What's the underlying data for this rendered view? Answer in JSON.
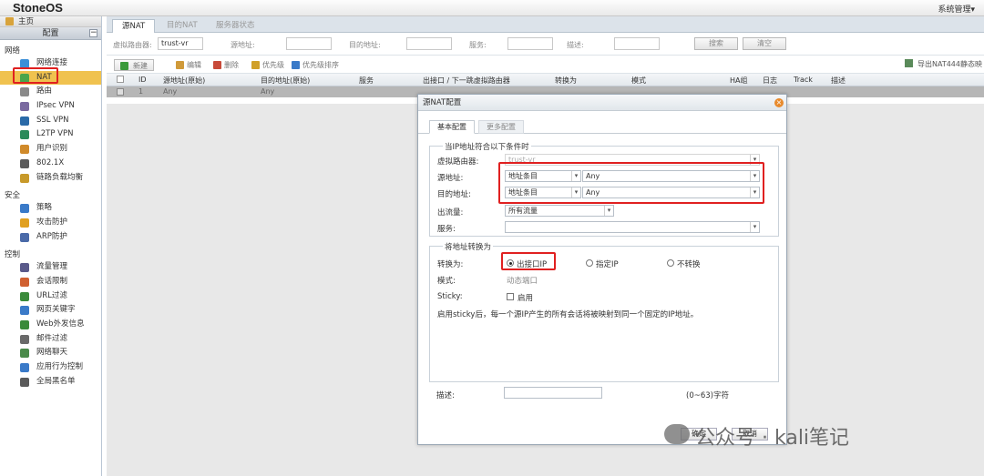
{
  "app": {
    "logo": "StoneOS",
    "system_menu": "系统管理▾"
  },
  "sidebar": {
    "home": "主页",
    "config": "配置",
    "collapse": "−",
    "sections": [
      {
        "title": "网络",
        "items": [
          {
            "label": "网络连接",
            "icon": "network-icon",
            "color": "#3a8fd8"
          },
          {
            "label": "NAT",
            "icon": "nat-icon",
            "color": "#4aa54a",
            "active": true
          },
          {
            "label": "路由",
            "icon": "route-icon",
            "color": "#8a8a8a"
          },
          {
            "label": "IPsec VPN",
            "icon": "vpn-icon",
            "color": "#7a6aa0"
          },
          {
            "label": "SSL VPN",
            "icon": "ssl-icon",
            "color": "#2a6aa8"
          },
          {
            "label": "L2TP VPN",
            "icon": "l2tp-icon",
            "color": "#2a8a5a"
          },
          {
            "label": "用户识别",
            "icon": "user-icon",
            "color": "#d08a2a"
          },
          {
            "label": "802.1X",
            "icon": "dot1x-icon",
            "color": "#5a5a5a"
          },
          {
            "label": "链路负载均衡",
            "icon": "balance-icon",
            "color": "#c89a2a"
          }
        ]
      },
      {
        "title": "安全",
        "items": [
          {
            "label": "策略",
            "icon": "policy-icon",
            "color": "#3a7ac8"
          },
          {
            "label": "攻击防护",
            "icon": "shield-icon",
            "color": "#e0a020"
          },
          {
            "label": "ARP防护",
            "icon": "arp-icon",
            "color": "#4a6aa8"
          }
        ]
      },
      {
        "title": "控制",
        "items": [
          {
            "label": "流量管理",
            "icon": "traffic-icon",
            "color": "#5a5a8a"
          },
          {
            "label": "会话限制",
            "icon": "session-icon",
            "color": "#d06030"
          },
          {
            "label": "URL过滤",
            "icon": "url-icon",
            "color": "#3a8a3a"
          },
          {
            "label": "网页关键字",
            "icon": "keyword-icon",
            "color": "#3a7ac8"
          },
          {
            "label": "Web外发信息",
            "icon": "web-icon",
            "color": "#3a8a3a"
          },
          {
            "label": "邮件过滤",
            "icon": "mail-icon",
            "color": "#6a6a6a"
          },
          {
            "label": "网络聊天",
            "icon": "chat-icon",
            "color": "#4a8a4a"
          },
          {
            "label": "应用行为控制",
            "icon": "app-icon",
            "color": "#3a7ac8"
          },
          {
            "label": "全局黑名单",
            "icon": "blacklist-icon",
            "color": "#5a5a5a"
          }
        ]
      }
    ]
  },
  "main": {
    "tabs": [
      "源NAT",
      "目的NAT",
      "服务器状态"
    ],
    "filter": {
      "vr_label": "虚拟路由器:",
      "vr_value": "trust-vr",
      "src_label": "源地址:",
      "dst_label": "目的地址:",
      "svc_label": "服务:",
      "desc_label": "描述:",
      "search": "搜索",
      "clear": "清空"
    },
    "toolbar": {
      "new": "新建",
      "edit": "编辑",
      "delete": "删除",
      "priority": "优先级",
      "priority_sort": "优先级排序",
      "export": "导出NAT444静态映"
    },
    "table": {
      "headers": [
        "ID",
        "源地址(原始)",
        "目的地址(原始)",
        "服务",
        "出接口 / 下一跳虚拟路由器",
        "转换为",
        "模式",
        "HA组",
        "日志",
        "Track",
        "描述"
      ],
      "rows": [
        {
          "id": "1",
          "src": "Any",
          "dst": "Any"
        }
      ]
    }
  },
  "dialog": {
    "title": "源NAT配置",
    "close": "×",
    "tabs": [
      "基本配置",
      "更多配置"
    ],
    "cond_legend": "当IP地址符合以下条件时",
    "vr_label": "虚拟路由器:",
    "vr_value": "trust-vr",
    "src_label": "源地址:",
    "src_type": "地址条目",
    "src_value": "Any",
    "dst_label": "目的地址:",
    "dst_type": "地址条目",
    "dst_value": "Any",
    "egress_label": "出流量:",
    "egress_value": "所有流量",
    "service_label": "服务:",
    "trans_legend": "将地址转换为",
    "trans_label": "转换为:",
    "opt_egress_ip": "出接口IP",
    "opt_specified_ip": "指定IP",
    "opt_no_trans": "不转换",
    "mode_label": "模式:",
    "mode_value": "动态端口",
    "sticky_label": "Sticky:",
    "sticky_enable": "启用",
    "sticky_note": "启用sticky后，每一个源IP产生的所有会话将被映射到同一个固定的IP地址。",
    "desc_label": "描述:",
    "desc_hint": "(0~63)字符",
    "ok": "确定",
    "cancel": "取消"
  },
  "watermark": "公众号 · kali笔记"
}
